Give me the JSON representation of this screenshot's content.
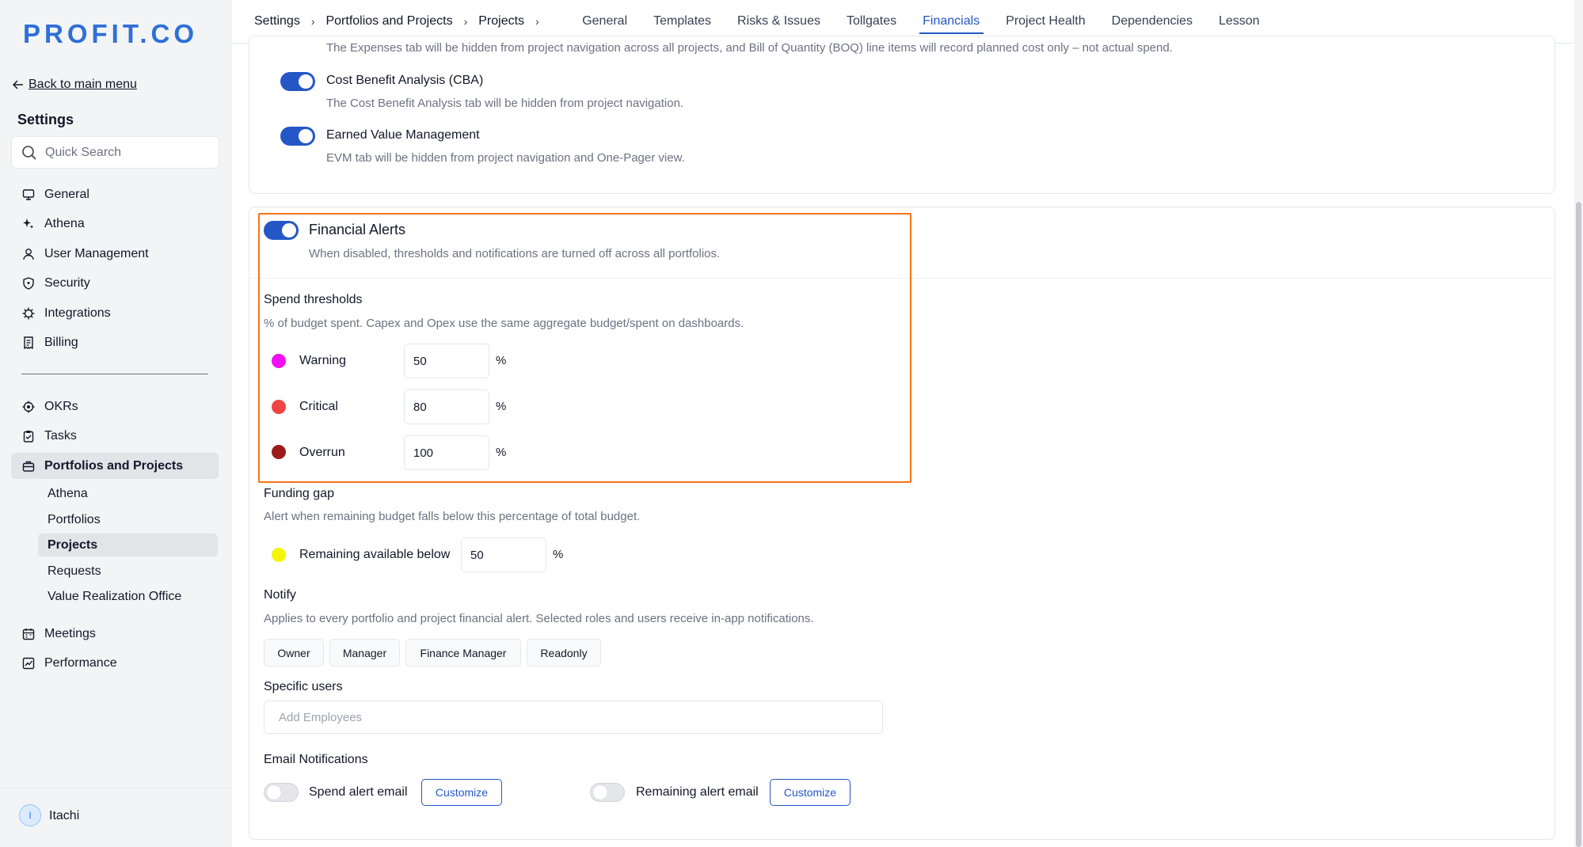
{
  "app": {
    "logo": "PROFIT.CO",
    "back_label": "Back to main menu",
    "settings_title": "Settings",
    "search_placeholder": "Quick Search",
    "user_initial": "I",
    "user_name": "Itachi"
  },
  "sidebar": {
    "group1": [
      {
        "label": "General",
        "icon": "monitor-icon"
      },
      {
        "label": "Athena",
        "icon": "sparkle-icon"
      },
      {
        "label": "User Management",
        "icon": "user-icon"
      },
      {
        "label": "Security",
        "icon": "shield-icon"
      },
      {
        "label": "Integrations",
        "icon": "gear-icon"
      },
      {
        "label": "Billing",
        "icon": "receipt-icon"
      }
    ],
    "group2": [
      {
        "label": "OKRs",
        "icon": "target-icon"
      },
      {
        "label": "Tasks",
        "icon": "clipboard-check-icon"
      },
      {
        "label": "Portfolios and Projects",
        "icon": "briefcase-icon",
        "active": true
      }
    ],
    "sub_items": [
      {
        "label": "Athena"
      },
      {
        "label": "Portfolios"
      },
      {
        "label": "Projects",
        "active": true
      },
      {
        "label": "Requests"
      },
      {
        "label": "Value Realization Office"
      }
    ],
    "group3": [
      {
        "label": "Meetings",
        "icon": "calendar-icon"
      },
      {
        "label": "Performance",
        "icon": "chart-icon"
      }
    ]
  },
  "breadcrumb": [
    "Settings",
    "Portfolios and Projects",
    "Projects"
  ],
  "tabs": [
    "General",
    "Templates",
    "Risks & Issues",
    "Tollgates",
    "Financials",
    "Project Health",
    "Dependencies",
    "Lesson"
  ],
  "active_tab": "Financials",
  "top_card": {
    "expenses_desc": "The Expenses tab will be hidden from project navigation across all projects, and Bill of Quantity (BOQ) line items will record planned cost only – not actual spend.",
    "cba_label": "Cost Benefit Analysis (CBA)",
    "cba_desc": "The Cost Benefit Analysis tab will be hidden from project navigation.",
    "evm_label": "Earned Value Management",
    "evm_desc": "EVM tab will be hidden from project navigation and One-Pager view."
  },
  "alerts": {
    "title": "Financial Alerts",
    "desc": "When disabled, thresholds and notifications are turned off across all portfolios.",
    "spend_title": "Spend thresholds",
    "spend_desc": "% of budget spent. Capex and Opex use the same aggregate budget/spent on dashboards.",
    "thresholds": [
      {
        "label": "Warning",
        "value": "50",
        "color": "#f20ff2"
      },
      {
        "label": "Critical",
        "value": "80",
        "color": "#ef4444"
      },
      {
        "label": "Overrun",
        "value": "100",
        "color": "#991b1b"
      }
    ],
    "percent": "%",
    "funding_title": "Funding gap",
    "funding_desc": "Alert when remaining budget falls below this percentage of total budget.",
    "funding_label": "Remaining available below",
    "funding_value": "50",
    "funding_color": "#f5f50a",
    "notify_title": "Notify",
    "notify_desc": "Applies to every portfolio and project financial alert. Selected roles and users receive in-app notifications.",
    "roles": [
      "Owner",
      "Manager",
      "Finance Manager",
      "Readonly"
    ],
    "users_title": "Specific users",
    "users_placeholder": "Add Employees",
    "email_title": "Email Notifications",
    "spend_email_label": "Spend alert email",
    "remaining_email_label": "Remaining alert email",
    "customize_label": "Customize"
  }
}
